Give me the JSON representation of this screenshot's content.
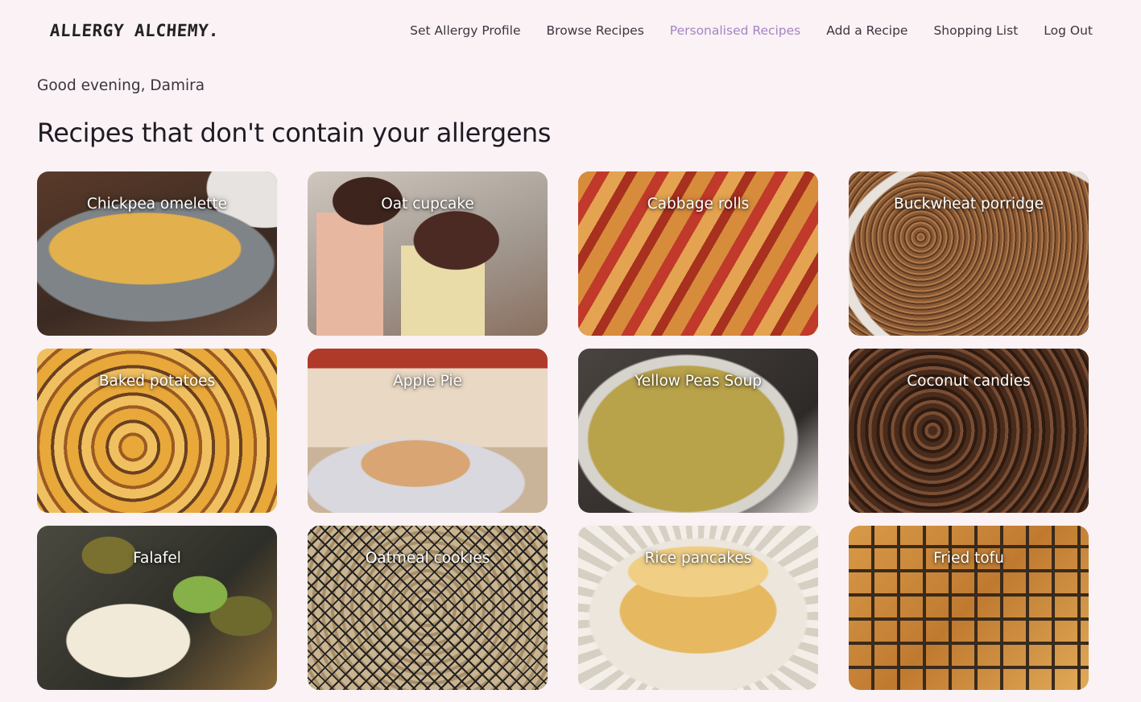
{
  "header": {
    "logo": "ALLERGY ALCHEMY.",
    "nav": [
      {
        "label": "Set Allergy Profile"
      },
      {
        "label": "Browse Recipes"
      },
      {
        "label": "Personalised Recipes",
        "active": true
      },
      {
        "label": "Add a Recipe"
      },
      {
        "label": "Shopping List"
      },
      {
        "label": "Log Out"
      }
    ]
  },
  "greeting": "Good evening, Damira",
  "heading": "Recipes that don't contain your allergens",
  "recipes": [
    {
      "title": "Chickpea omelette"
    },
    {
      "title": "Oat cupcake"
    },
    {
      "title": "Cabbage rolls"
    },
    {
      "title": "Buckwheat porridge"
    },
    {
      "title": "Baked potatoes"
    },
    {
      "title": "Apple Pie"
    },
    {
      "title": "Yellow Peas Soup"
    },
    {
      "title": "Coconut candies"
    },
    {
      "title": "Falafel"
    },
    {
      "title": "Oatmeal cookies"
    },
    {
      "title": "Rice pancakes"
    },
    {
      "title": "Fried tofu"
    }
  ],
  "colors": {
    "background": "#faf2f4",
    "active_nav": "#a584c4",
    "heading": "#1f1a24"
  }
}
